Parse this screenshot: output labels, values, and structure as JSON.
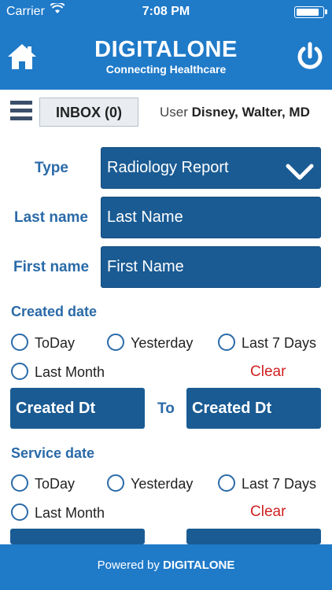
{
  "status_bar": {
    "carrier": "Carrier",
    "time": "7:08 PM"
  },
  "header": {
    "brand_name": "DIGITALONE",
    "brand_tagline": "Connecting Healthcare"
  },
  "toolbar": {
    "inbox_label": "INBOX (0)",
    "user_prefix": "User",
    "user_name": "Disney, Walter, MD"
  },
  "form": {
    "type_label": "Type",
    "type_value": "Radiology Report",
    "last_name_label": "Last name",
    "last_name_placeholder": "Last Name",
    "first_name_label": "First name",
    "first_name_placeholder": "First Name"
  },
  "created_date": {
    "title": "Created date",
    "options": [
      "ToDay",
      "Yesterday",
      "Last 7 Days",
      "Last Month"
    ],
    "clear": "Clear",
    "from_placeholder": "Created Dt",
    "to_label": "To",
    "to_placeholder": "Created Dt"
  },
  "service_date": {
    "title": "Service date",
    "options": [
      "ToDay",
      "Yesterday",
      "Last 7 Days",
      "Last Month"
    ],
    "clear": "Clear"
  },
  "footer": {
    "powered_by": "Powered by",
    "brand": "DIGITALONE"
  },
  "colors": {
    "header_blue": "#1f7ac8",
    "field_blue": "#1a5b93",
    "label_blue": "#2a6aa8",
    "clear_red": "#d02020"
  },
  "icons": [
    "wifi-icon",
    "battery-icon",
    "home-icon",
    "power-icon",
    "menu-icon",
    "chevron-down-icon",
    "radio-icon"
  ]
}
